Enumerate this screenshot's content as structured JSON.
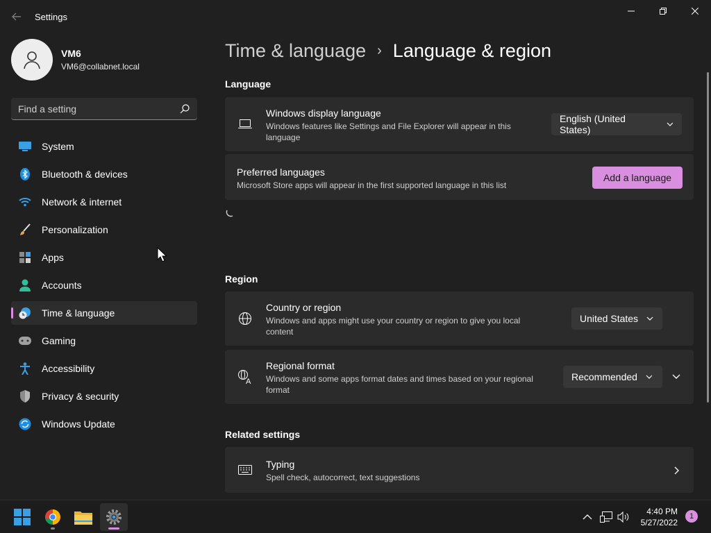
{
  "window": {
    "title": "Settings"
  },
  "profile": {
    "name": "VM6",
    "email": "VM6@collabnet.local"
  },
  "search": {
    "placeholder": "Find a setting"
  },
  "sidebar": {
    "items": [
      {
        "label": "System",
        "icon": "system-icon"
      },
      {
        "label": "Bluetooth & devices",
        "icon": "bluetooth-icon"
      },
      {
        "label": "Network & internet",
        "icon": "wifi-icon"
      },
      {
        "label": "Personalization",
        "icon": "brush-icon"
      },
      {
        "label": "Apps",
        "icon": "apps-icon"
      },
      {
        "label": "Accounts",
        "icon": "person-icon"
      },
      {
        "label": "Time & language",
        "icon": "clock-globe-icon",
        "active": true
      },
      {
        "label": "Gaming",
        "icon": "gamepad-icon"
      },
      {
        "label": "Accessibility",
        "icon": "accessibility-icon"
      },
      {
        "label": "Privacy & security",
        "icon": "shield-icon"
      },
      {
        "label": "Windows Update",
        "icon": "update-icon"
      }
    ]
  },
  "breadcrumb": {
    "parent": "Time & language",
    "separator": "›",
    "current": "Language & region"
  },
  "language": {
    "heading": "Language",
    "display_language": {
      "title": "Windows display language",
      "desc": "Windows features like Settings and File Explorer will appear in this language",
      "value": "English (United States)"
    },
    "preferred": {
      "title": "Preferred languages",
      "desc": "Microsoft Store apps will appear in the first supported language in this list",
      "button": "Add a language"
    }
  },
  "region": {
    "heading": "Region",
    "country": {
      "title": "Country or region",
      "desc": "Windows and apps might use your country or region to give you local content",
      "value": "United States"
    },
    "format": {
      "title": "Regional format",
      "desc": "Windows and some apps format dates and times based on your regional format",
      "value": "Recommended"
    }
  },
  "related": {
    "heading": "Related settings",
    "typing": {
      "title": "Typing",
      "desc": "Spell check, autocorrect, text suggestions"
    }
  },
  "taskbar": {
    "apps": [
      "start-icon",
      "chrome-icon",
      "file-explorer-icon",
      "settings-icon"
    ],
    "time": "4:40 PM",
    "date": "5/27/2022",
    "notification_count": "1"
  },
  "colors": {
    "accent": "#d98ee0",
    "background": "#202020",
    "card": "#2b2b2b"
  }
}
